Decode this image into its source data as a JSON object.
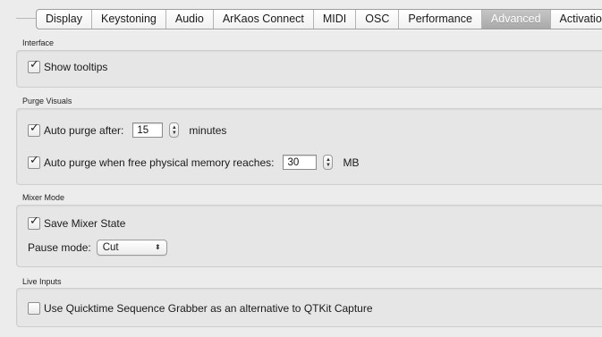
{
  "tabs": [
    {
      "label": "Display",
      "active": false
    },
    {
      "label": "Keystoning",
      "active": false
    },
    {
      "label": "Audio",
      "active": false
    },
    {
      "label": "ArKaos Connect",
      "active": false
    },
    {
      "label": "MIDI",
      "active": false
    },
    {
      "label": "OSC",
      "active": false
    },
    {
      "label": "Performance",
      "active": false
    },
    {
      "label": "Advanced",
      "active": true
    },
    {
      "label": "Activation",
      "active": false
    }
  ],
  "interface": {
    "title": "Interface",
    "show_tooltips_label": "Show tooltips",
    "show_tooltips_checked": true
  },
  "purge": {
    "title": "Purge Visuals",
    "auto_purge_label": "Auto purge after:",
    "auto_purge_value": "15",
    "auto_purge_unit": "minutes",
    "auto_purge_checked": true,
    "memory_label": "Auto purge when free physical memory reaches:",
    "memory_value": "30",
    "memory_unit": "MB",
    "memory_checked": true
  },
  "mixer": {
    "title": "Mixer Mode",
    "save_state_label": "Save Mixer State",
    "save_state_checked": true,
    "pause_mode_label": "Pause mode:",
    "pause_mode_value": "Cut"
  },
  "live": {
    "title": "Live Inputs",
    "quicktime_label": "Use Quicktime Sequence Grabber as an alternative to QTKit Capture",
    "quicktime_checked": false
  },
  "icons": {
    "checkbox": "checkmark-icon",
    "stepper": "stepper-arrows-icon",
    "select": "updown-chevron-icon"
  }
}
